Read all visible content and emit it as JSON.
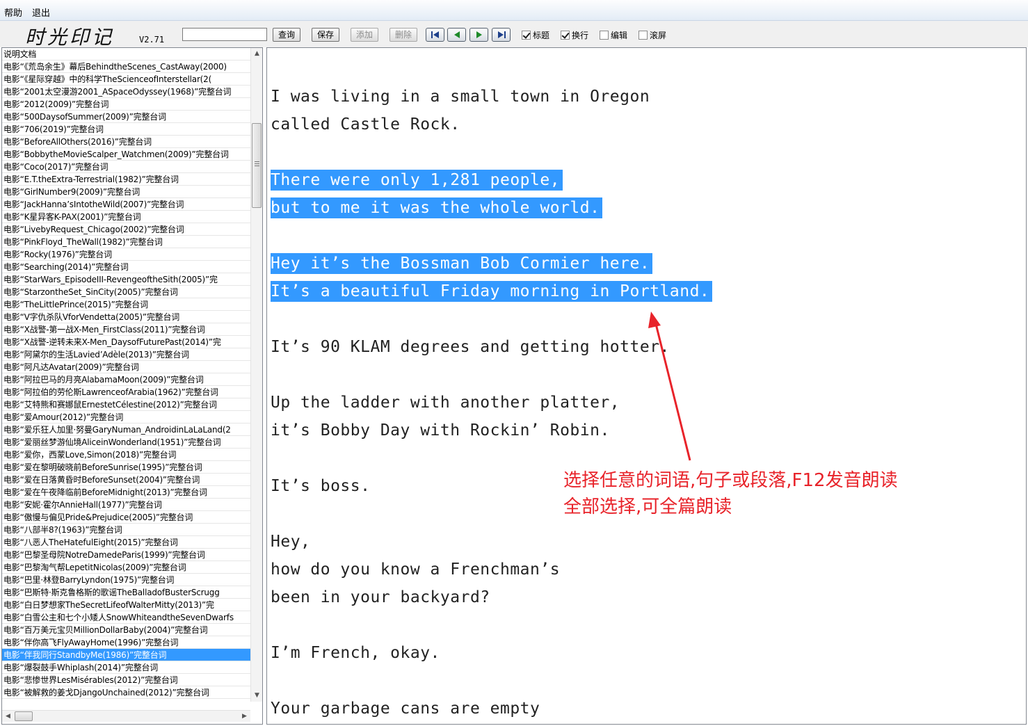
{
  "menu": {
    "help": "帮助",
    "exit": "退出"
  },
  "toolbar": {
    "logo": "时光印记",
    "version": "V2.71",
    "search_value": "",
    "query_label": "查询",
    "save_label": "保存",
    "add_label": "添加",
    "delete_label": "删除",
    "checkboxes": [
      {
        "label": "标题",
        "checked": true
      },
      {
        "label": "换行",
        "checked": true
      },
      {
        "label": "编辑",
        "checked": false
      },
      {
        "label": "滚屏",
        "checked": false
      }
    ]
  },
  "list": {
    "selected_index": 48,
    "items": [
      "说明文档",
      "电影“《荒岛余生》幕后BehindtheScenes_CastAway(2000)",
      "电影“《星际穿越》中的科学TheScienceofInterstellar(2(",
      "电影“2001太空漫游2001_ASpaceOdyssey(1968)”完整台词",
      "电影“2012(2009)”完整台词",
      "电影“500DaysofSummer(2009)”完整台词",
      "电影“706(2019)”完整台词",
      "电影“BeforeAllOthers(2016)”完整台词",
      "电影“BobbytheMovieScalper_Watchmen(2009)”完整台词",
      "电影“Coco(2017)”完整台词",
      "电影“E.T.theExtra-Terrestrial(1982)”完整台词",
      "电影“GirlNumber9(2009)”完整台词",
      "电影“JackHanna’sIntotheWild(2007)”完整台词",
      "电影“K星异客K-PAX(2001)”完整台词",
      "电影“LivebyRequest_Chicago(2002)”完整台词",
      "电影“PinkFloyd_TheWall(1982)”完整台词",
      "电影“Rocky(1976)”完整台词",
      "电影“Searching(2014)”完整台词",
      "电影“StarWars_EpisodeIII-RevengeoftheSith(2005)”完",
      "电影“StarzontheSet_SinCity(2005)”完整台词",
      "电影“TheLittlePrince(2015)”完整台词",
      "电影“V字仇杀队VforVendetta(2005)”完整台词",
      "电影“X战警-第一战X-Men_FirstClass(2011)”完整台词",
      "电影“X战警-逆转未来X-Men_DaysofFuturePast(2014)”完",
      "电影“阿黛尔的生活Lavied’Adèle(2013)”完整台词",
      "电影“阿凡达Avatar(2009)”完整台词",
      "电影“阿拉巴马的月亮AlabamaMoon(2009)”完整台词",
      "电影“阿拉伯的劳伦斯LawrenceofArabia(1962)”完整台词",
      "电影“艾特熊和赛娜鼠ErnestetCélestine(2012)”完整台词",
      "电影“爱Amour(2012)”完整台词",
      "电影“爱乐狂人加里·努曼GaryNuman_AndroidinLaLaLand(2",
      "电影“爱丽丝梦游仙境AliceinWonderland(1951)”完整台词",
      "电影“爱你，西蒙Love,Simon(2018)”完整台词",
      "电影“爱在黎明破晓前BeforeSunrise(1995)”完整台词",
      "电影“爱在日落黄昏时BeforeSunset(2004)”完整台词",
      "电影“爱在午夜降临前BeforeMidnight(2013)”完整台词",
      "电影“安妮·霍尔AnnieHall(1977)”完整台词",
      "电影“傲慢与偏见Pride&Prejudice(2005)”完整台词",
      "电影“八部半8?(1963)”完整台词",
      "电影“八恶人TheHatefulEight(2015)”完整台词",
      "电影“巴黎圣母院NotreDamedeParis(1999)”完整台词",
      "电影“巴黎淘气帮LepetitNicolas(2009)”完整台词",
      "电影“巴里·林登BarryLyndon(1975)”完整台词",
      "电影“巴斯特·斯克鲁格斯的歌谣TheBalladofBusterScrugg",
      "电影“白日梦想家TheSecretLifeofWalterMitty(2013)”完",
      "电影“白雪公主和七个小矮人SnowWhiteandtheSevenDwarfs",
      "电影“百万美元宝贝MillionDollarBaby(2004)”完整台词",
      "电影“伴你高飞FlyAwayHome(1996)”完整台词",
      "电影“伴我同行StandbyMe(1986)”完整台词",
      "电影“爆裂鼓手Whiplash(2014)”完整台词",
      "电影“悲惨世界LesMisérables(2012)”完整台词",
      "电影“被解救的姜戈DjangoUnchained(2012)”完整台词"
    ]
  },
  "text": {
    "lines": [
      {
        "text": "I was living in a small town in Oregon",
        "selected": false
      },
      {
        "text": "called Castle Rock.",
        "selected": false
      },
      {
        "text": "",
        "selected": false
      },
      {
        "text": "There were only 1,281 people,",
        "selected": true
      },
      {
        "text": "but to me it was the whole world.",
        "selected": true
      },
      {
        "text": "",
        "selected": false
      },
      {
        "text": "Hey it’s the Bossman Bob Cormier here.",
        "selected": true
      },
      {
        "text": "It’s a beautiful Friday morning in Portland.",
        "selected": true
      },
      {
        "text": "",
        "selected": false
      },
      {
        "text": "It’s 90 KLAM degrees and getting hotter.",
        "selected": false
      },
      {
        "text": "",
        "selected": false
      },
      {
        "text": "Up the ladder with another platter,",
        "selected": false
      },
      {
        "text": "it’s Bobby Day with Rockin’ Robin.",
        "selected": false
      },
      {
        "text": "",
        "selected": false
      },
      {
        "text": "It’s boss.",
        "selected": false
      },
      {
        "text": "",
        "selected": false
      },
      {
        "text": "Hey,",
        "selected": false
      },
      {
        "text": "how do you know a Frenchman’s",
        "selected": false
      },
      {
        "text": "been in your backyard?",
        "selected": false
      },
      {
        "text": "",
        "selected": false
      },
      {
        "text": "I’m French, okay.",
        "selected": false
      },
      {
        "text": "",
        "selected": false
      },
      {
        "text": "Your garbage cans are empty",
        "selected": false
      }
    ]
  },
  "annotation": {
    "line1": "选择任意的词语,句子或段落,F12发音朗读",
    "line2": "全部选择,可全篇朗读",
    "color": "#e8232a"
  },
  "colors": {
    "selection": "#3399ff"
  }
}
